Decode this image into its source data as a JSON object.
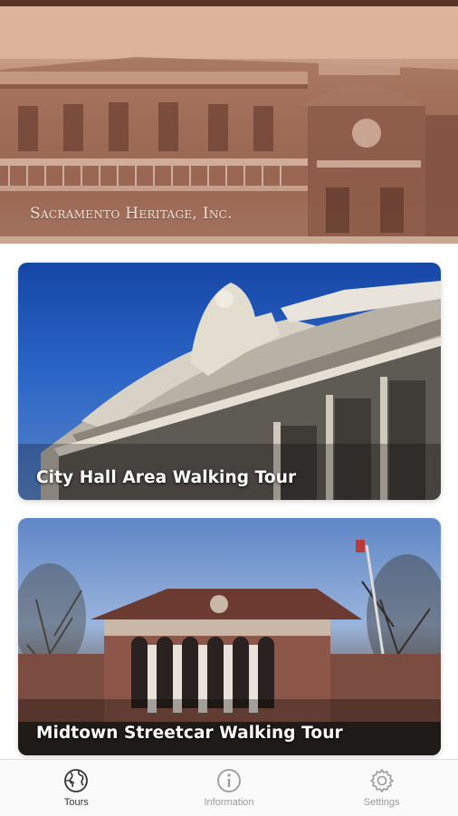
{
  "header": {
    "org_name": "Sacramento Heritage, Inc."
  },
  "tours": [
    {
      "title": "City Hall Area Walking Tour"
    },
    {
      "title": "Midtown Streetcar Walking Tour"
    }
  ],
  "tabbar": {
    "tabs": [
      {
        "label": "Tours",
        "icon": "globe-icon",
        "active": true
      },
      {
        "label": "Information",
        "icon": "info-icon",
        "active": false
      },
      {
        "label": "Settings",
        "icon": "gear-icon",
        "active": false
      }
    ]
  },
  "colors": {
    "header_tint": "#a8755f",
    "tab_active": "#333333",
    "tab_inactive": "#9a9a9a"
  }
}
